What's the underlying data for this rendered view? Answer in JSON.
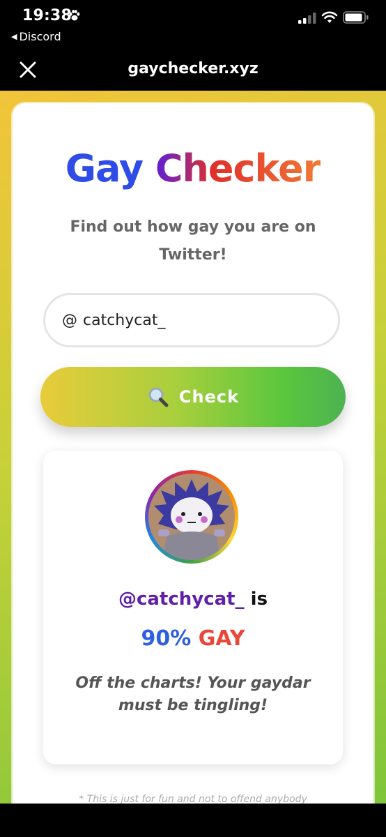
{
  "status_bar": {
    "time": "19:38",
    "back_app": "Discord"
  },
  "nav": {
    "title": "gaychecker.xyz"
  },
  "app": {
    "title_part1": "Gay",
    "title_part2": "Checker",
    "subtitle": "Find out how gay you are on Twitter!",
    "input_prefix": "@",
    "input_value": "catchycat_",
    "check_label": "Check"
  },
  "result": {
    "handle": "@catchycat_",
    "is_text": "is",
    "percent": "90%",
    "gay_word": "GAY",
    "verdict": "Off the charts! Your gaydar must be tingling!"
  },
  "footer": {
    "disclaimer": "* This is just for fun and not to offend anybody"
  },
  "colors": {
    "title_blue": "#2f4ce6",
    "handle_purple": "#5f1fa8",
    "gay_red": "#e8473a"
  }
}
